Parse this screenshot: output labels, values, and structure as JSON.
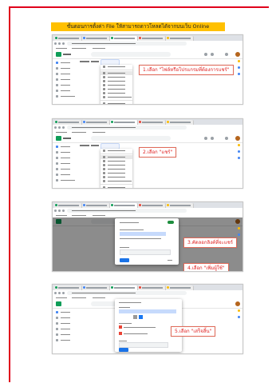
{
  "page": {
    "title": "ขั้นตอนการตั้งค่า File ให้สามารถดาวโหลดได้จากบนเว็บ Online",
    "colors": {
      "border": "#e0001b",
      "title_bg": "#ffc000",
      "callout_text": "#e02020"
    }
  },
  "steps": [
    {
      "callout": "1.เลือก \"ไฟล์หรือโปรแกรมที่ต้องการแชร์\""
    },
    {
      "callout": "2.เลือก \"แชร์\""
    },
    {
      "callout_a": "3.คัดลอกลิงค์ที่จะแชร์",
      "callout_b": "4.เลือก \"เพิ่มผู้ใช้\""
    },
    {
      "callout": "5.เลือก \"เสร็จสิ้น\""
    }
  ],
  "icons": [
    "drive-logo-icon",
    "search-icon",
    "settings-icon",
    "apps-icon",
    "avatar-icon",
    "share-icon",
    "link-icon"
  ]
}
